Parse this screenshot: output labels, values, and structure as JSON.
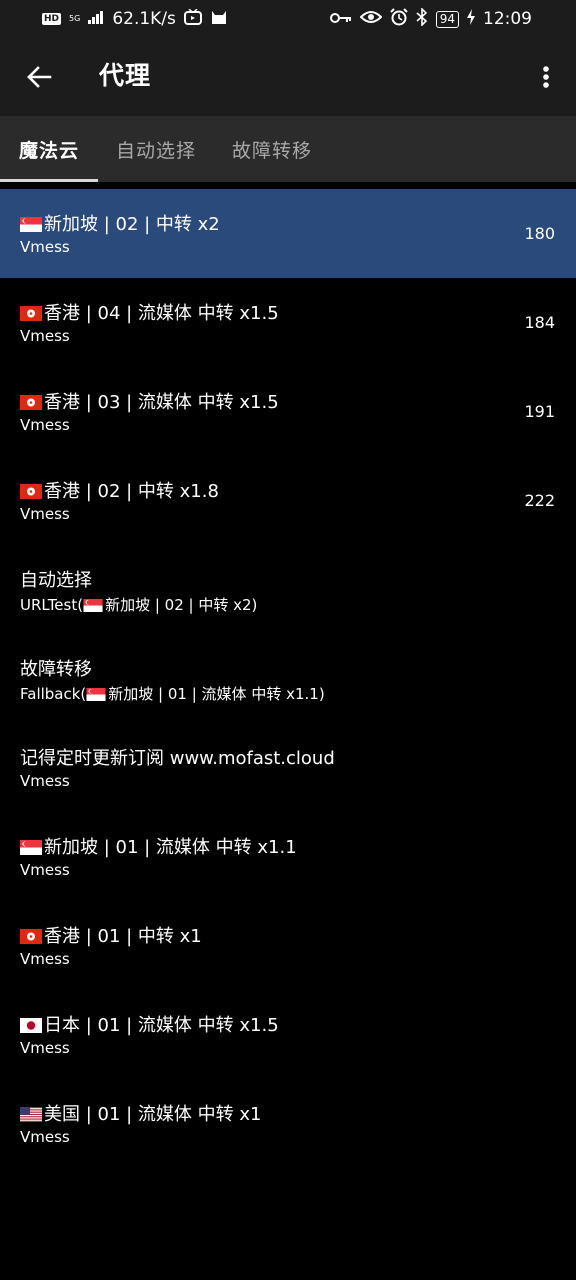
{
  "status_bar": {
    "hd": "HD",
    "network": "5G",
    "speed": "62.1K/s",
    "battery": "94",
    "time": "12:09"
  },
  "app_bar": {
    "title": "代理",
    "back_icon": "arrow-left-icon",
    "more_icon": "more-vert-icon"
  },
  "tabs": [
    {
      "label": "魔法云",
      "active": true
    },
    {
      "label": "自动选择",
      "active": false
    },
    {
      "label": "故障转移",
      "active": false
    }
  ],
  "proxies": [
    {
      "flag": "sg",
      "title": "新加坡 | 02 | 中转 x2",
      "type": "Vmess",
      "latency": "180",
      "selected": true
    },
    {
      "flag": "hk",
      "title": "香港 | 04 | 流媒体 中转 x1.5",
      "type": "Vmess",
      "latency": "184"
    },
    {
      "flag": "hk",
      "title": "香港 | 03 | 流媒体 中转 x1.5",
      "type": "Vmess",
      "latency": "191"
    },
    {
      "flag": "hk",
      "title": "香港 | 02 | 中转 x1.8",
      "type": "Vmess",
      "latency": "222"
    },
    {
      "flag": "",
      "title": "自动选择",
      "type_prefix": "URLTest(",
      "type_flag": "sg",
      "type_rest": "新加坡 | 02 | 中转 x2)",
      "latency": ""
    },
    {
      "flag": "",
      "title": "故障转移",
      "type_prefix": "Fallback(",
      "type_flag": "sg",
      "type_rest": "新加坡 | 01 | 流媒体 中转 x1.1)",
      "latency": ""
    },
    {
      "flag": "",
      "title": "记得定时更新订阅 www.mofast.cloud",
      "type": "Vmess",
      "latency": ""
    },
    {
      "flag": "sg",
      "title": "新加坡 | 01 | 流媒体 中转 x1.1",
      "type": "Vmess",
      "latency": ""
    },
    {
      "flag": "hk",
      "title": "香港 | 01 | 中转 x1",
      "type": "Vmess",
      "latency": ""
    },
    {
      "flag": "jp",
      "title": "日本 | 01 | 流媒体 中转 x1.5",
      "type": "Vmess",
      "latency": ""
    },
    {
      "flag": "us",
      "title": "美国 | 01 | 流媒体 中转 x1",
      "type": "Vmess",
      "latency": ""
    }
  ]
}
